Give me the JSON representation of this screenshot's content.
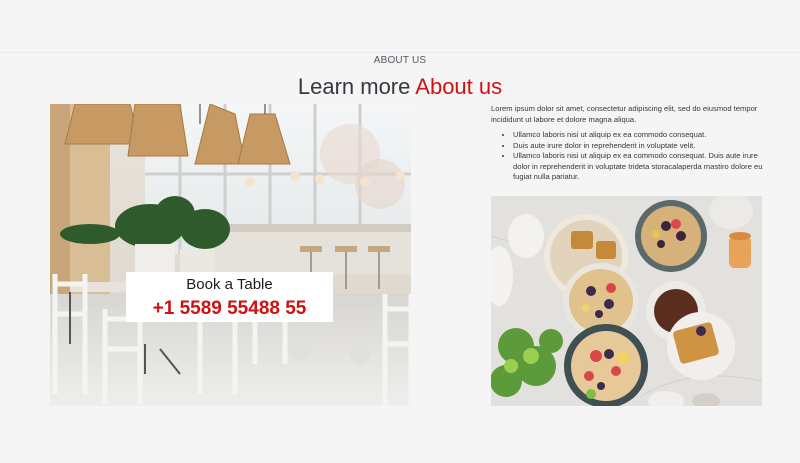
{
  "section": {
    "tag": "ABOUT US",
    "title_prefix": "Learn more",
    "title_accent": "About us"
  },
  "booking": {
    "title": "Book a Table",
    "phone": "+1 5589 55488 55"
  },
  "about": {
    "intro": "Lorem ipsum dolor sit amet, consectetur adipiscing elit, sed do eiusmod tempor incididunt ut labore et dolore magna aliqua.",
    "bullets": [
      "Ullamco laboris nisi ut aliquip ex ea commodo consequat.",
      "Duis aute irure dolor in reprehenderit in voluptate velit.",
      "Ullamco laboris nisi ut aliquip ex ea commodo consequat. Duis aute irure dolor in reprehenderit in voluptate trideta storacalaperda mastiro dolore eu fugiat nulla pariatur."
    ]
  },
  "colors": {
    "accent": "#ce1212",
    "heading": "#37373f",
    "background": "#f5f5f6"
  },
  "images": {
    "left": "restaurant-interior-photo",
    "right": "breakfast-food-photo"
  }
}
